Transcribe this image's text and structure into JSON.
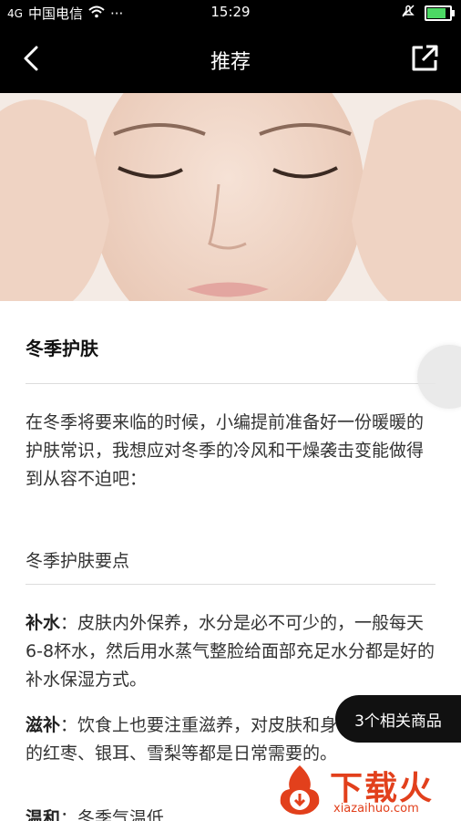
{
  "status_bar": {
    "network": "4G",
    "carrier": "中国电信",
    "more": "···",
    "time": "15:29"
  },
  "nav": {
    "title": "推荐"
  },
  "article": {
    "title": "冬季护肤",
    "intro": "在冬季将要来临的时候，小编提前准备好一份暖暖的护肤常识，我想应对冬季的冷风和干燥袭击变能做得到从容不迫吧：",
    "section_heading": "冬季护肤要点",
    "points": [
      {
        "label": "补水",
        "text": "：皮肤内外保养，水分是必不可少的，一般每天6-8杯水，然后用水蒸气整脸给面部充足水分都是好的补水保湿方式。"
      },
      {
        "label": "滋补",
        "text": "：饮食上也要注重滋养，对皮肤和身体都有益处的红枣、银耳、雪梨等都是日常需要的。"
      },
      {
        "label": "温和",
        "text": "：冬季气温低..."
      }
    ]
  },
  "related_button": "3个相关商品",
  "watermark": {
    "brand": "下载火",
    "url": "xiazaihuo.com"
  },
  "colors": {
    "bar": "#000000",
    "watermark": "#e2401c",
    "battery": "#4cd964"
  }
}
